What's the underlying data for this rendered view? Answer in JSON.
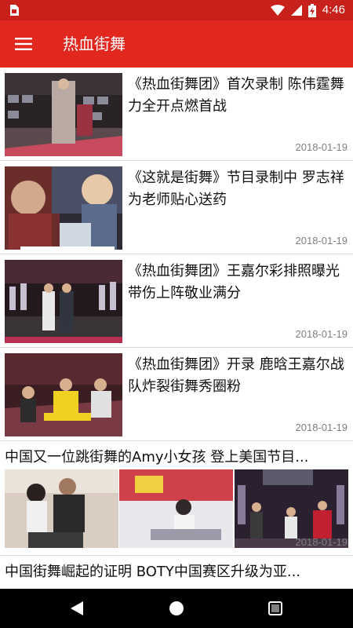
{
  "status_bar": {
    "time": "4:46",
    "icons": [
      "sim-card-icon",
      "wifi-icon",
      "signal-icon",
      "battery-charging-icon"
    ]
  },
  "app_bar": {
    "title": "热血街舞",
    "menu_icon": "menu-icon"
  },
  "feed": {
    "items": [
      {
        "title": "《热血街舞团》首次录制 陈伟霆舞力全开点燃首战",
        "date": "2018-01-19"
      },
      {
        "title": "《这就是街舞》节目录制中 罗志祥为老师贴心送药",
        "date": "2018-01-19"
      },
      {
        "title": "《热血街舞团》王嘉尔彩排照曝光 带伤上阵敬业满分",
        "date": "2018-01-19"
      },
      {
        "title": "《热血街舞团》开录 鹿晗王嘉尔战队炸裂街舞秀圈粉",
        "date": "2018-01-19"
      }
    ],
    "multi_item": {
      "title": "中国又一位跳街舞的Amy小女孩 登上美国节目...",
      "date": "2018-01-19"
    },
    "partial_item": {
      "title": "中国街舞崛起的证明 BOTY中国赛区升级为亚..."
    }
  },
  "nav_bar": {
    "icons": [
      "back-icon",
      "home-icon",
      "recents-icon"
    ]
  },
  "colors": {
    "status_bar": "#c8201b",
    "app_bar": "#e2271e",
    "date_text": "#808080"
  }
}
